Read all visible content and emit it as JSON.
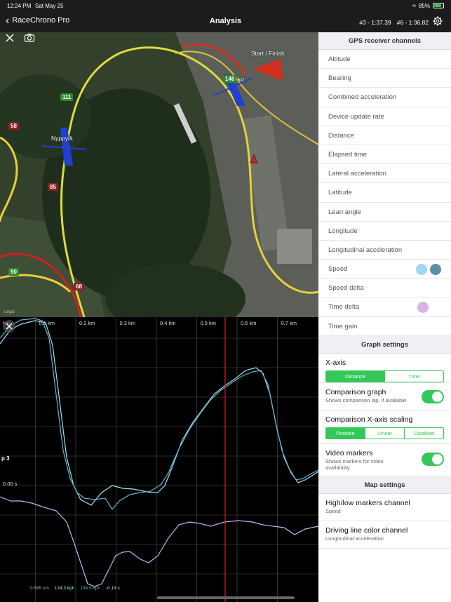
{
  "status": {
    "time": "12:24 PM",
    "date": "Sat May 25",
    "battery": "85%",
    "battery_level": 0.85
  },
  "nav": {
    "back_label": "RaceChrono Pro",
    "title": "Analysis",
    "lap_a": "#3 - 1:37.39",
    "lap_b": "#6 - 1:36.82"
  },
  "map": {
    "markers": [
      "111",
      "58",
      "146",
      "85",
      "90",
      "68"
    ],
    "labels": {
      "start_finish": "Start / Finish",
      "nyppyla": "Nyppylä",
      "ko": "ko"
    },
    "legal": "Legal"
  },
  "graph": {
    "km_ticks": [
      "km",
      "0.1 km",
      "0.2 km",
      "0.3 km",
      "0.4 km",
      "0.5 km",
      "0.6 km",
      "0.7 km",
      "0"
    ],
    "lap_label": "p 3",
    "zero_label": "0.00 s",
    "readout": {
      "distance": "0.585 km",
      "speed_a": "134.3 kph",
      "speed_b": "134.5 kph",
      "delta": "-0.13 s"
    },
    "colors": {
      "speed_a": "#9fe3f5",
      "speed_b": "#5fb4d4",
      "time_delta": "#d8a8f0",
      "cursor": "#e02020"
    }
  },
  "panel": {
    "gps_header": "GPS receiver channels",
    "channels": [
      {
        "label": "Altitude"
      },
      {
        "label": "Bearing"
      },
      {
        "label": "Combined acceleration"
      },
      {
        "label": "Device update rate"
      },
      {
        "label": "Distance"
      },
      {
        "label": "Elapsed time"
      },
      {
        "label": "Lateral acceleration"
      },
      {
        "label": "Latitude"
      },
      {
        "label": "Lean angle"
      },
      {
        "label": "Longitude"
      },
      {
        "label": "Longitudinal acceleration"
      },
      {
        "label": "Speed"
      },
      {
        "label": "Speed delta"
      },
      {
        "label": "Time delta"
      },
      {
        "label": "Time gain"
      }
    ],
    "speed_dot_colors": [
      "#9fd8ee",
      "#5b8fa6"
    ],
    "time_delta_dot_color": "#d7b3ea",
    "graph_header": "Graph settings",
    "xaxis_label": "X-axis",
    "xaxis_options": [
      "Distance",
      "Time"
    ],
    "comparison_graph_label": "Comparison graph",
    "comparison_graph_sub": "Shows comparison lap, if available",
    "comparison_scaling_label": "Comparison X-axis scaling",
    "scaling_options": [
      "Position",
      "Linear",
      "Disabled"
    ],
    "video_markers_label": "Video markers",
    "video_markers_sub": "Shows markers for video availability",
    "map_header": "Map settings",
    "highlow_label": "High/low markers channel",
    "highlow_sub": "Speed",
    "driving_line_label": "Driving line color channel",
    "driving_line_sub": "Longitudinal acceleration",
    "accent": "#34c759"
  }
}
